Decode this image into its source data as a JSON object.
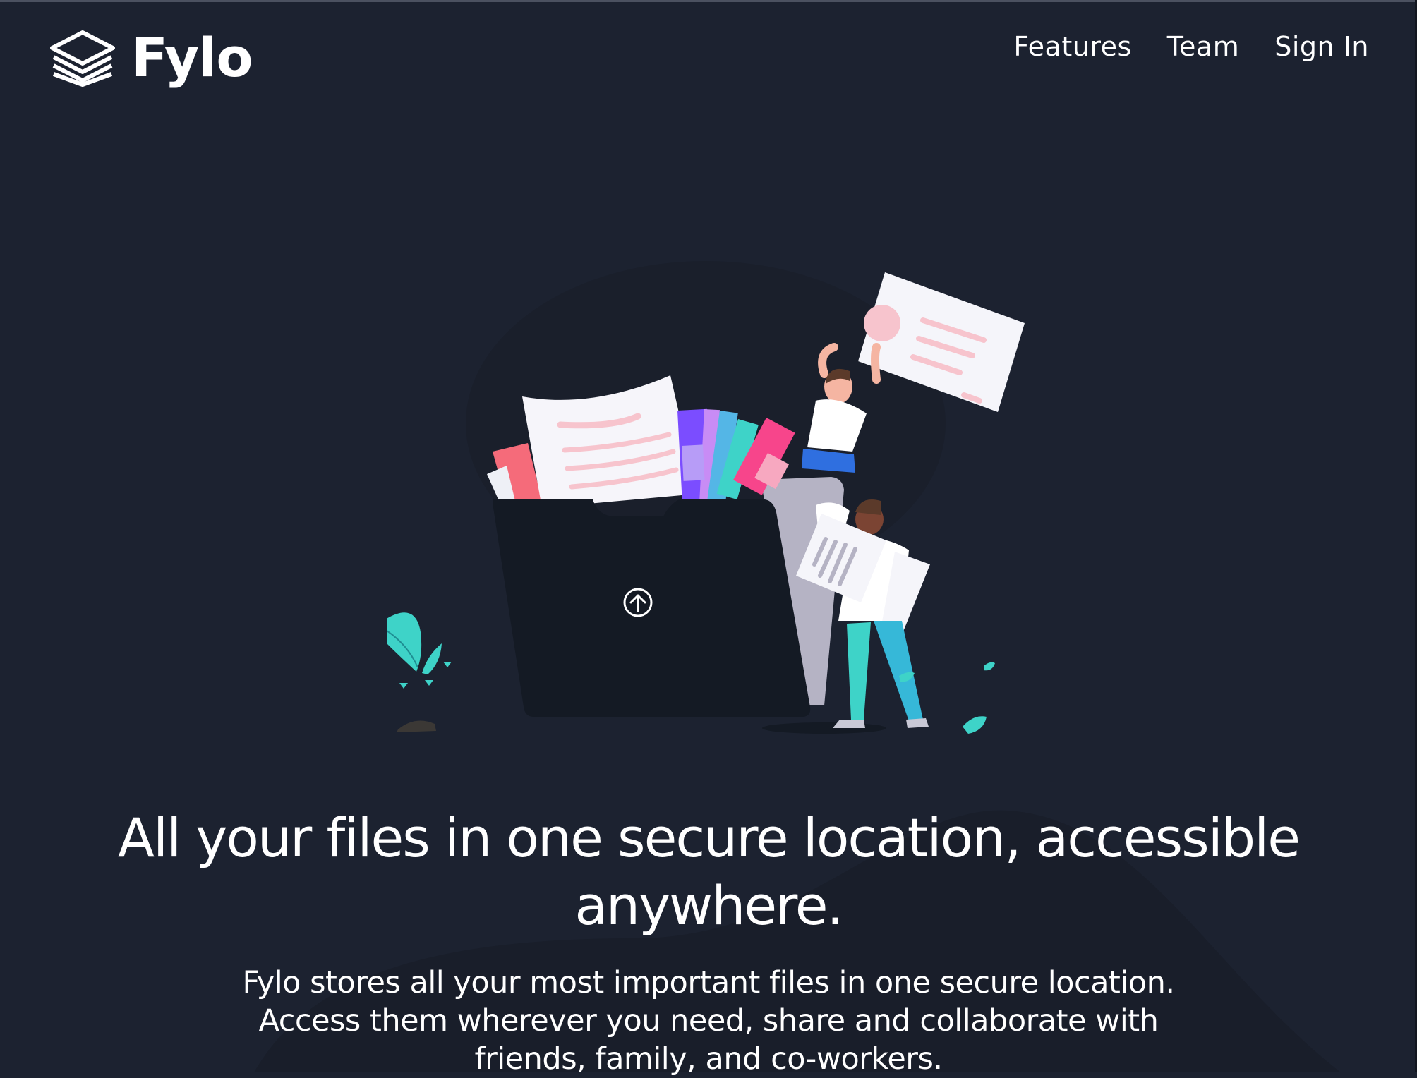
{
  "brand": {
    "name": "Fylo",
    "logo_icon": "stacked-layers-icon"
  },
  "nav": {
    "items": [
      {
        "label": "Features"
      },
      {
        "label": "Team"
      },
      {
        "label": "Sign In"
      }
    ]
  },
  "hero": {
    "illustration": "people-uploading-files-to-folder-illustration",
    "upload_icon": "upload-arrow-icon",
    "title": "All your files in one secure location, accessible anywhere.",
    "subtitle": "Fylo stores all your most important files in one secure location. Access them wherever you need, share and collaborate with friends, family, and co-workers."
  },
  "colors": {
    "background": "#1c2230",
    "text": "#ffffff",
    "folder": "#141a24",
    "accent_cyan": "#3ed3c8",
    "accent_pink": "#f7b5c5",
    "accent_purple": "#7b4dff"
  }
}
